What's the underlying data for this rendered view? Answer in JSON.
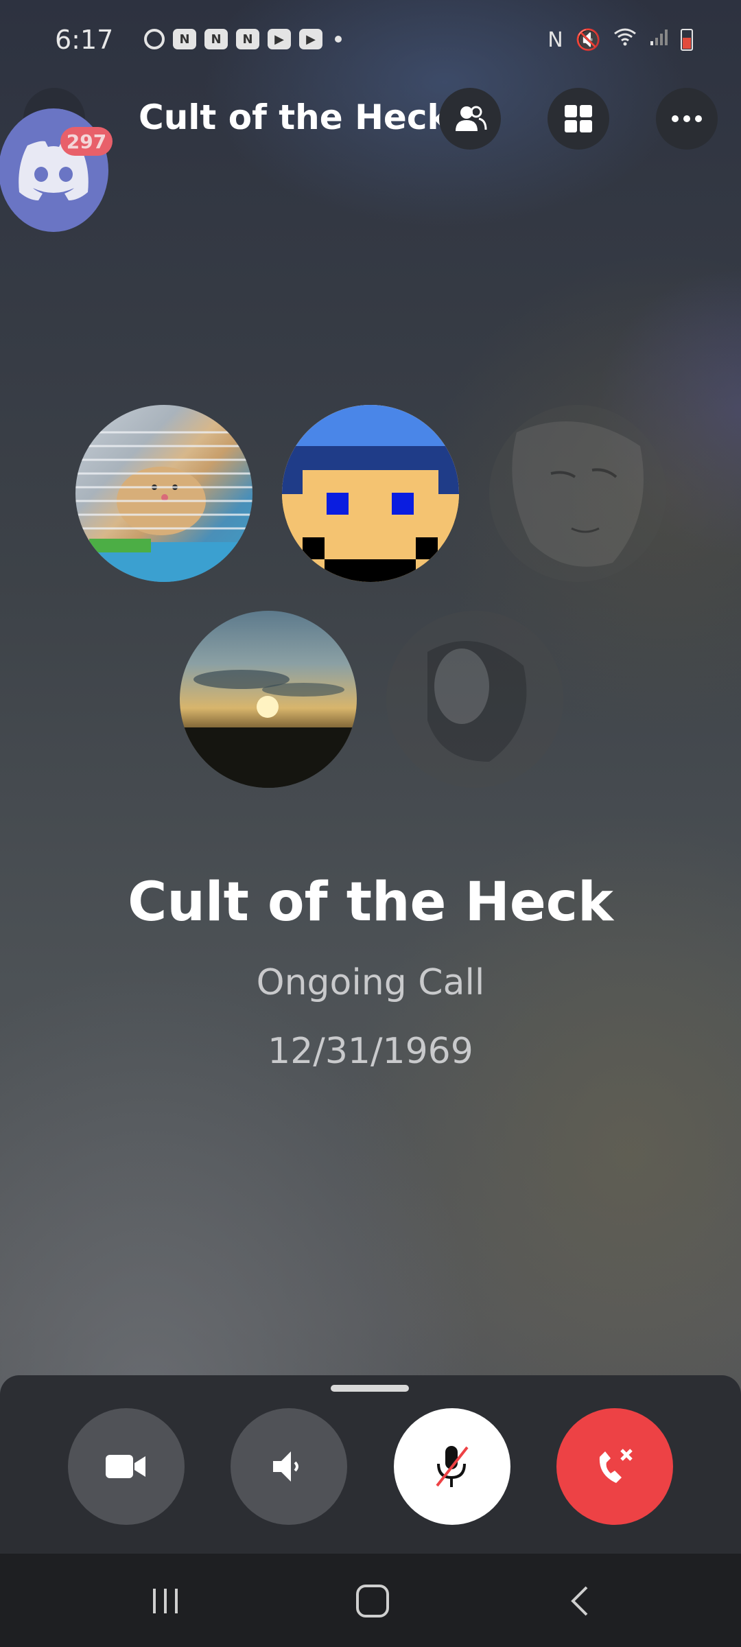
{
  "status_bar": {
    "time": "6:17",
    "notification_icons": [
      "sync-icon",
      "app-icon",
      "app-icon",
      "app-icon",
      "youtube-icon",
      "youtube-icon"
    ],
    "system_icons": [
      "nfc-icon",
      "mute-icon",
      "wifi-icon",
      "signal-icon",
      "battery-icon"
    ]
  },
  "header": {
    "title": "Cult of the Heck",
    "actions": [
      "members-icon",
      "grid-icon",
      "more-icon"
    ]
  },
  "notification_bubble": {
    "badge_count": "297"
  },
  "participants": [
    {
      "name": "participant-1",
      "active": true
    },
    {
      "name": "participant-2",
      "active": true
    },
    {
      "name": "participant-3",
      "active": false
    },
    {
      "name": "participant-4",
      "active": true
    },
    {
      "name": "participant-5",
      "active": false
    }
  ],
  "call": {
    "title": "Cult of the Heck",
    "status": "Ongoing Call",
    "date": "12/31/1969"
  },
  "controls": [
    "video-camera",
    "speaker",
    "microphone-muted",
    "hang-up"
  ],
  "colors": {
    "accent_red": "#ed4245",
    "blurple": "#6a75c4",
    "panel": "#2c2e33"
  }
}
